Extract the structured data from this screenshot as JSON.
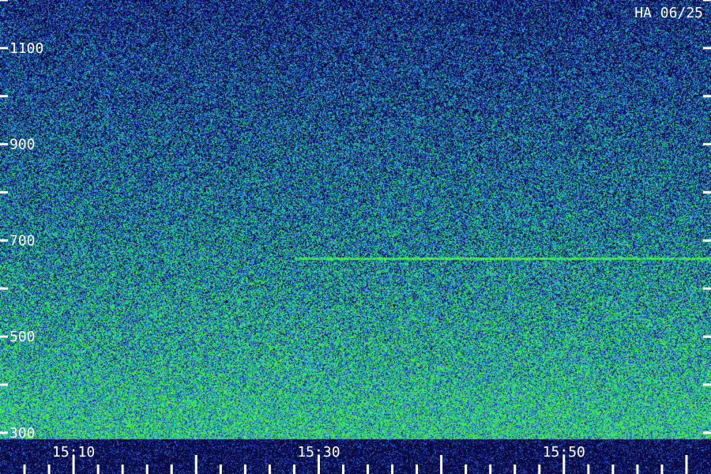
{
  "chart_data": {
    "type": "heatmap",
    "title": "HA 06/25",
    "xlabel": "",
    "ylabel": "",
    "x_ticks": [
      "15:10",
      "15:30",
      "15:50"
    ],
    "x_tick_minutes": [
      10,
      30,
      50
    ],
    "x_range_minutes": [
      4,
      62
    ],
    "y_ticks": [
      1100,
      900,
      700,
      500,
      300
    ],
    "y_minor_ticks": [
      1200,
      1000,
      800,
      600,
      400
    ],
    "y_range": [
      1200,
      280
    ],
    "colormap": [
      "#0a0a40",
      "#1c2ab0",
      "#2a7ad8",
      "#22c8a8",
      "#28e060",
      "#60f040"
    ],
    "features": [
      {
        "label": "narrowband line",
        "y_value": 663,
        "x_start_minutes": 28,
        "x_end_minutes": 62
      }
    ]
  },
  "colors": {
    "background": "#000000",
    "label": "#ffffff"
  }
}
